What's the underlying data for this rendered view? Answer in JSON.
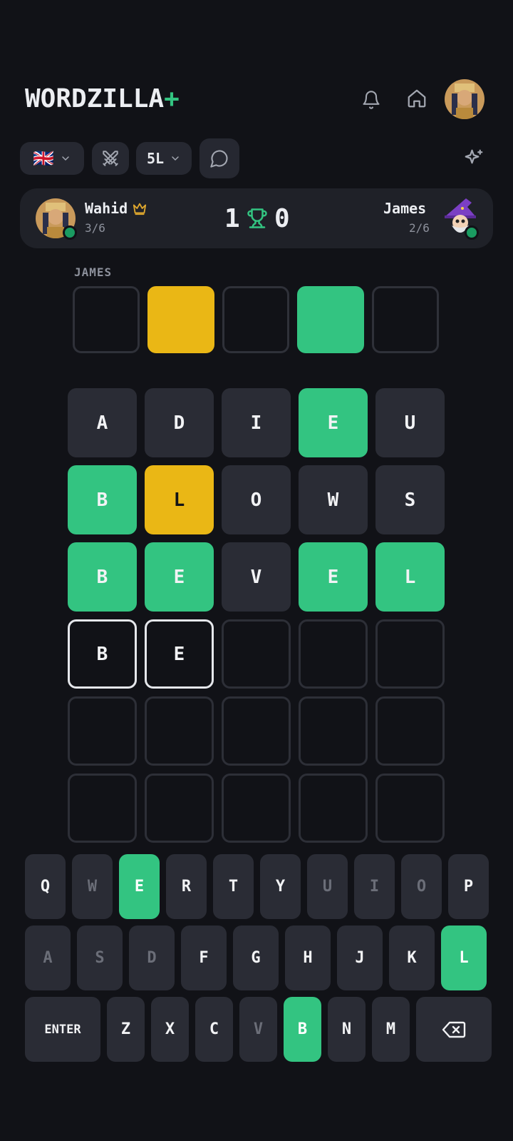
{
  "header": {
    "logo_text": "WORDZILLA",
    "logo_plus": "+",
    "icons": [
      "bell-icon",
      "home-icon"
    ]
  },
  "toolbar": {
    "language_flag": "🇬🇧",
    "length_label": "5L",
    "icons": [
      "flag-icon",
      "swords-icon",
      "chat-icon",
      "sparkles-icon"
    ]
  },
  "match": {
    "player": {
      "name": "Wahid",
      "progress": "3/6"
    },
    "opponent": {
      "name": "James",
      "progress": "2/6"
    },
    "score_left": "1",
    "score_right": "0"
  },
  "opponent_board": {
    "label": "JAMES",
    "tiles": [
      "empty",
      "yellow",
      "empty",
      "green",
      "empty"
    ]
  },
  "board": [
    [
      {
        "l": "A",
        "s": "absent"
      },
      {
        "l": "D",
        "s": "absent"
      },
      {
        "l": "I",
        "s": "absent"
      },
      {
        "l": "E",
        "s": "correct"
      },
      {
        "l": "U",
        "s": "absent"
      }
    ],
    [
      {
        "l": "B",
        "s": "correct"
      },
      {
        "l": "L",
        "s": "present"
      },
      {
        "l": "O",
        "s": "absent"
      },
      {
        "l": "W",
        "s": "absent"
      },
      {
        "l": "S",
        "s": "absent"
      }
    ],
    [
      {
        "l": "B",
        "s": "correct"
      },
      {
        "l": "E",
        "s": "correct"
      },
      {
        "l": "V",
        "s": "absent"
      },
      {
        "l": "E",
        "s": "correct"
      },
      {
        "l": "L",
        "s": "correct"
      }
    ],
    [
      {
        "l": "B",
        "s": "typed"
      },
      {
        "l": "E",
        "s": "typed"
      },
      {
        "l": "",
        "s": "empty"
      },
      {
        "l": "",
        "s": "empty"
      },
      {
        "l": "",
        "s": "empty"
      }
    ],
    [
      {
        "l": "",
        "s": "empty"
      },
      {
        "l": "",
        "s": "empty"
      },
      {
        "l": "",
        "s": "empty"
      },
      {
        "l": "",
        "s": "empty"
      },
      {
        "l": "",
        "s": "empty"
      }
    ],
    [
      {
        "l": "",
        "s": "empty"
      },
      {
        "l": "",
        "s": "empty"
      },
      {
        "l": "",
        "s": "empty"
      },
      {
        "l": "",
        "s": "empty"
      },
      {
        "l": "",
        "s": "empty"
      }
    ]
  ],
  "keyboard": {
    "row1": [
      {
        "k": "Q",
        "s": "normal"
      },
      {
        "k": "W",
        "s": "dim"
      },
      {
        "k": "E",
        "s": "correct"
      },
      {
        "k": "R",
        "s": "normal"
      },
      {
        "k": "T",
        "s": "normal"
      },
      {
        "k": "Y",
        "s": "normal"
      },
      {
        "k": "U",
        "s": "dim"
      },
      {
        "k": "I",
        "s": "dim"
      },
      {
        "k": "O",
        "s": "dim"
      },
      {
        "k": "P",
        "s": "normal"
      }
    ],
    "row2": [
      {
        "k": "A",
        "s": "dim"
      },
      {
        "k": "S",
        "s": "dim"
      },
      {
        "k": "D",
        "s": "dim"
      },
      {
        "k": "F",
        "s": "normal"
      },
      {
        "k": "G",
        "s": "normal"
      },
      {
        "k": "H",
        "s": "normal"
      },
      {
        "k": "J",
        "s": "normal"
      },
      {
        "k": "K",
        "s": "normal"
      },
      {
        "k": "L",
        "s": "correct"
      }
    ],
    "row3": [
      {
        "k": "ENTER",
        "s": "enter"
      },
      {
        "k": "Z",
        "s": "normal"
      },
      {
        "k": "X",
        "s": "normal"
      },
      {
        "k": "C",
        "s": "normal"
      },
      {
        "k": "V",
        "s": "dim"
      },
      {
        "k": "B",
        "s": "correct"
      },
      {
        "k": "N",
        "s": "normal"
      },
      {
        "k": "M",
        "s": "normal"
      },
      {
        "k": "",
        "s": "backspace"
      }
    ]
  },
  "colors": {
    "background": "#111217",
    "correct": "#33c481",
    "present": "#eab715",
    "absent": "#2a2c35"
  }
}
